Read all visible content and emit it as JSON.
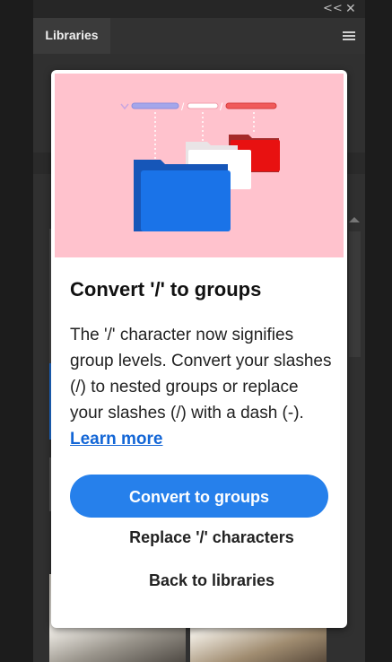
{
  "panel": {
    "tab_label": "Libraries",
    "collapse_glyph": "<<",
    "close_glyph": "✕"
  },
  "dialog": {
    "title": "Convert '/' to groups",
    "body_text": "The '/' character now signifies group levels. Convert your slashes (/) to nested groups or replace your slashes (/) with a dash (-). ",
    "learn_more_label": "Learn more",
    "primary_button_label": "Convert to groups",
    "replace_button_label": "Replace '/' characters",
    "back_button_label": "Back to libraries"
  },
  "hero": {
    "separator_glyph": "/",
    "colors": {
      "background": "#ffc2cd",
      "pill_blue": "#a4a6ea",
      "pill_white": "#ffffff",
      "pill_red": "#f05a5a",
      "folder_blue": "#1a73e8",
      "folder_white": "#ffffff",
      "folder_red": "#e81111"
    }
  },
  "colors": {
    "accent": "#2680eb",
    "link": "#1366d6"
  }
}
